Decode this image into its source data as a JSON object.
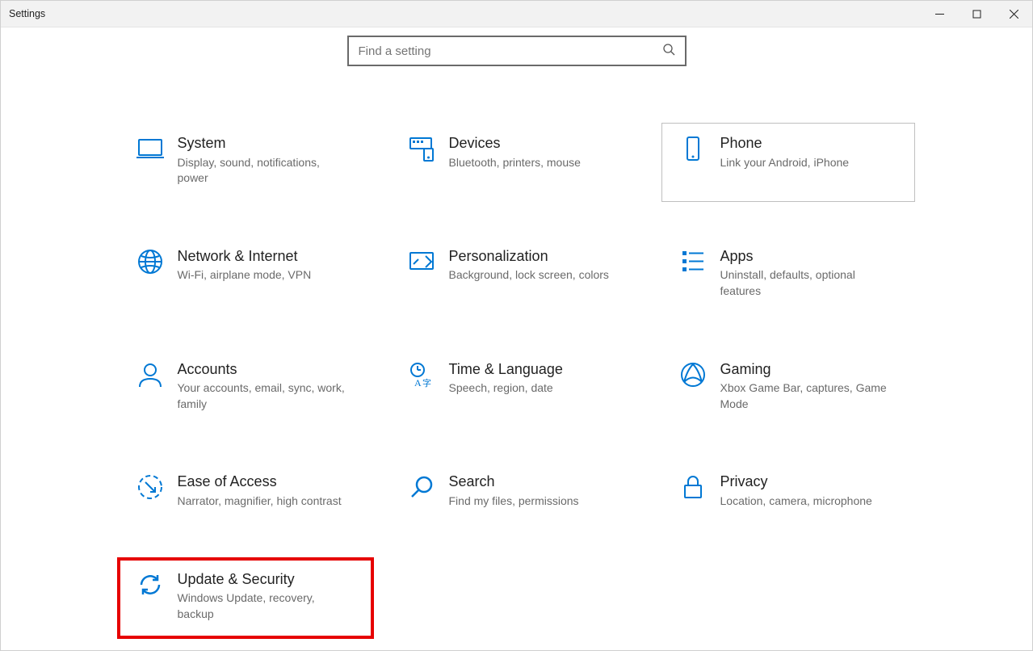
{
  "window": {
    "title": "Settings"
  },
  "search": {
    "placeholder": "Find a setting"
  },
  "tiles": {
    "system": {
      "title": "System",
      "desc": "Display, sound, notifications, power"
    },
    "devices": {
      "title": "Devices",
      "desc": "Bluetooth, printers, mouse"
    },
    "phone": {
      "title": "Phone",
      "desc": "Link your Android, iPhone"
    },
    "network": {
      "title": "Network & Internet",
      "desc": "Wi-Fi, airplane mode, VPN"
    },
    "personalization": {
      "title": "Personalization",
      "desc": "Background, lock screen, colors"
    },
    "apps": {
      "title": "Apps",
      "desc": "Uninstall, defaults, optional features"
    },
    "accounts": {
      "title": "Accounts",
      "desc": "Your accounts, email, sync, work, family"
    },
    "time": {
      "title": "Time & Language",
      "desc": "Speech, region, date"
    },
    "gaming": {
      "title": "Gaming",
      "desc": "Xbox Game Bar, captures, Game Mode"
    },
    "ease": {
      "title": "Ease of Access",
      "desc": "Narrator, magnifier, high contrast"
    },
    "searcht": {
      "title": "Search",
      "desc": "Find my files, permissions"
    },
    "privacy": {
      "title": "Privacy",
      "desc": "Location, camera, microphone"
    },
    "update": {
      "title": "Update & Security",
      "desc": "Windows Update, recovery, backup"
    }
  }
}
